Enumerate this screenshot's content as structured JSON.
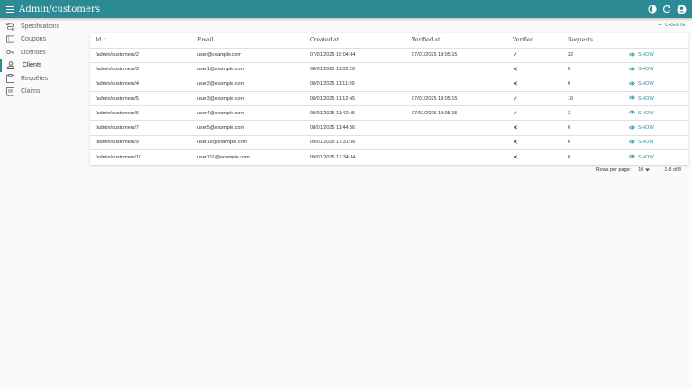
{
  "app": {
    "title": "Admin/customers"
  },
  "colors": {
    "primary": "#2b8a94"
  },
  "header_icons": [
    "contrast-icon",
    "refresh-icon",
    "account-icon"
  ],
  "sidebar": {
    "items": [
      {
        "label": "Specifications",
        "icon": "route-icon"
      },
      {
        "label": "Coupons",
        "icon": "coupon-icon"
      },
      {
        "label": "Licenses",
        "icon": "key-icon"
      },
      {
        "label": "Clients",
        "icon": "person-icon",
        "active": true
      },
      {
        "label": "Requêtes",
        "icon": "clipboard-icon"
      },
      {
        "label": "Claims",
        "icon": "receipt-icon"
      }
    ]
  },
  "actions": {
    "create_label": "CREATE"
  },
  "table": {
    "columns": [
      "Id",
      "Email",
      "Created at",
      "Verified at",
      "Verified",
      "Requests"
    ],
    "sort_indicator": "↑",
    "show_label": "SHOW",
    "rows": [
      {
        "id": "/admin/customers/2",
        "email": "user@example.com",
        "created": "07/01/2025 18:04:44",
        "verified_at": "07/01/2025 18:05:15",
        "verified": true,
        "requests": "32"
      },
      {
        "id": "/admin/customers/3",
        "email": "user1@example.com",
        "created": "08/01/2025 11:02:26",
        "verified_at": "",
        "verified": false,
        "requests": "0"
      },
      {
        "id": "/admin/customers/4",
        "email": "user2@example.com",
        "created": "08/01/2025 11:11:09",
        "verified_at": "",
        "verified": false,
        "requests": "0"
      },
      {
        "id": "/admin/customers/5",
        "email": "user3@example.com",
        "created": "08/01/2025 11:12:45",
        "verified_at": "07/01/2025 18:05:15",
        "verified": true,
        "requests": "16"
      },
      {
        "id": "/admin/customers/6",
        "email": "user4@example.com",
        "created": "08/01/2025 11:42:45",
        "verified_at": "07/01/2025 18:05:15",
        "verified": true,
        "requests": "3"
      },
      {
        "id": "/admin/customers/7",
        "email": "user5@example.com",
        "created": "08/01/2025 11:44:56",
        "verified_at": "",
        "verified": false,
        "requests": "0"
      },
      {
        "id": "/admin/customers/9",
        "email": "user18@example.com",
        "created": "09/01/2025 17:31:56",
        "verified_at": "",
        "verified": false,
        "requests": "0"
      },
      {
        "id": "/admin/customers/10",
        "email": "user118@example.com",
        "created": "09/01/2025 17:34:34",
        "verified_at": "",
        "verified": false,
        "requests": "0"
      }
    ]
  },
  "pagination": {
    "rows_per_page_label": "Rows per page:",
    "rows_per_page": "10",
    "range": "1-8 of 8"
  }
}
